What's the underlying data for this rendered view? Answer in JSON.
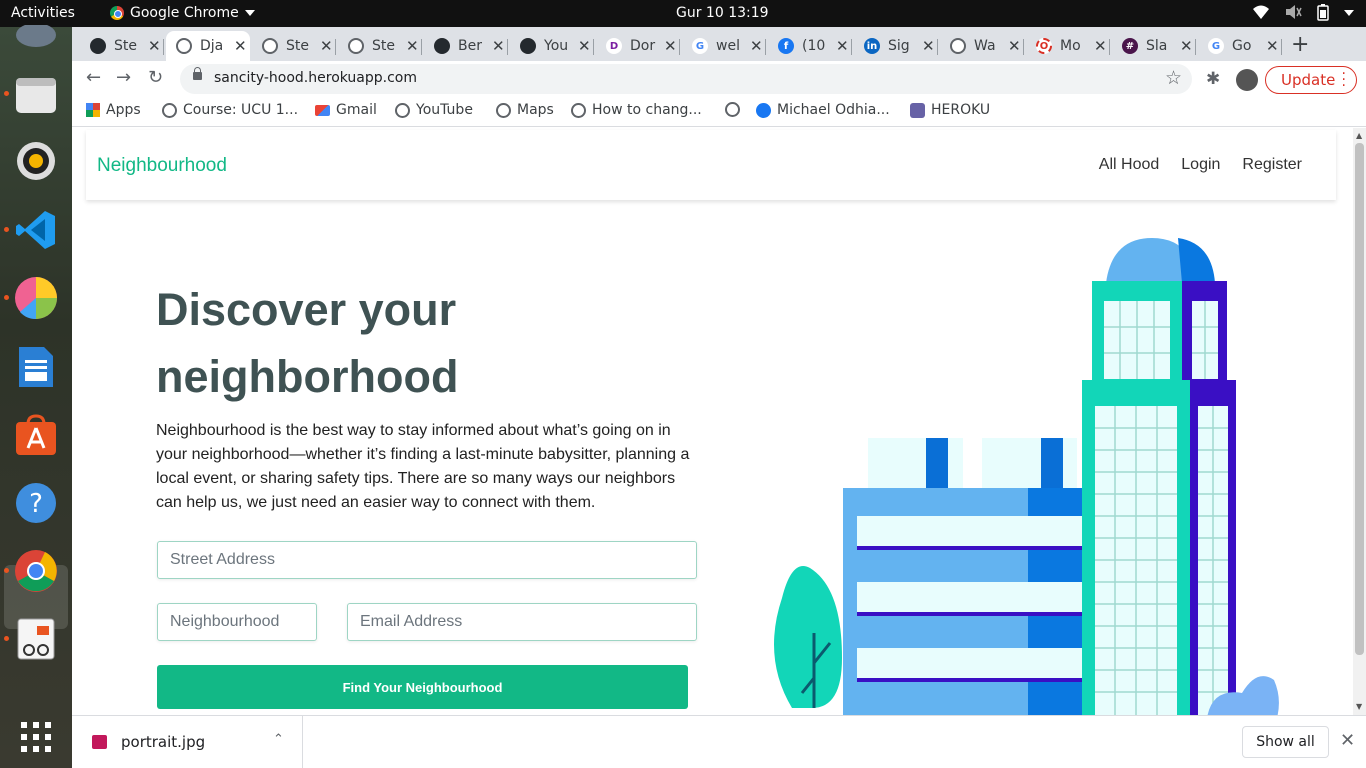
{
  "topbar": {
    "activities": "Activities",
    "app_name": "Google Chrome",
    "clock": "Gur 10  13:19"
  },
  "dock": {
    "items": [
      "thunderbird-icon",
      "files-icon",
      "rhythmbox-icon",
      "vscode-icon",
      "chart-app-icon",
      "libreoffice-writer-icon",
      "software-center-icon",
      "help-icon",
      "chrome-icon",
      "text-editor-icon",
      "show-apps-icon"
    ]
  },
  "tabs": [
    {
      "label": "Ste",
      "icon": "github-icon"
    },
    {
      "label": "Dja",
      "icon": "globe-icon",
      "active": true
    },
    {
      "label": "Ste",
      "icon": "globe-icon"
    },
    {
      "label": "Ste",
      "icon": "globe-icon"
    },
    {
      "label": "Ber",
      "icon": "github-icon"
    },
    {
      "label": "You",
      "icon": "github-icon"
    },
    {
      "label": "Dor",
      "icon": "d-icon"
    },
    {
      "label": "wel",
      "icon": "google-icon"
    },
    {
      "label": "(10",
      "icon": "facebook-icon"
    },
    {
      "label": "Sig",
      "icon": "linkedin-icon"
    },
    {
      "label": "Wa",
      "icon": "globe-icon"
    },
    {
      "label": "Mo",
      "icon": "opera-icon"
    },
    {
      "label": "Sla",
      "icon": "slack-icon"
    },
    {
      "label": "Go",
      "icon": "google-icon"
    }
  ],
  "toolbar": {
    "url": "sancity-hood.herokuapp.com",
    "update_label": "Update"
  },
  "bookmarks": [
    {
      "label": "Apps",
      "icon": "apps-grid-icon"
    },
    {
      "label": "Course: UCU 1...",
      "icon": "globe-icon"
    },
    {
      "label": "Gmail",
      "icon": "gmail-icon"
    },
    {
      "label": "YouTube",
      "icon": "globe-icon"
    },
    {
      "label": "Maps",
      "icon": "globe-icon"
    },
    {
      "label": "How to chang...",
      "icon": "globe-icon"
    },
    {
      "label": "",
      "icon": "globe-icon"
    },
    {
      "label": "Michael Odhia...",
      "icon": "facebook-icon"
    },
    {
      "label": "HEROKU",
      "icon": "heroku-icon"
    }
  ],
  "site": {
    "brand": "Neighbourhood",
    "nav": [
      "All Hood",
      "Login",
      "Register"
    ],
    "hero_line1": "Discover your",
    "hero_line2": "neighborhood",
    "description": "Neighbourhood is the best way to stay informed about what’s going on in your neighborhood—whether it’s finding a last-minute babysitter, planning a local event, or sharing safety tips. There are so many ways our neighbors can help us, we just need an easier way to connect with them.",
    "street_placeholder": "Street Address",
    "hood_placeholder": "Neighbourhood",
    "email_placeholder": "Email Address",
    "button": "Find Your Neighbourhood"
  },
  "downloads": {
    "file": "portrait.jpg",
    "show_all": "Show all"
  },
  "colors": {
    "accent": "#12b886",
    "heading": "#3f5253",
    "update": "#d93025"
  }
}
